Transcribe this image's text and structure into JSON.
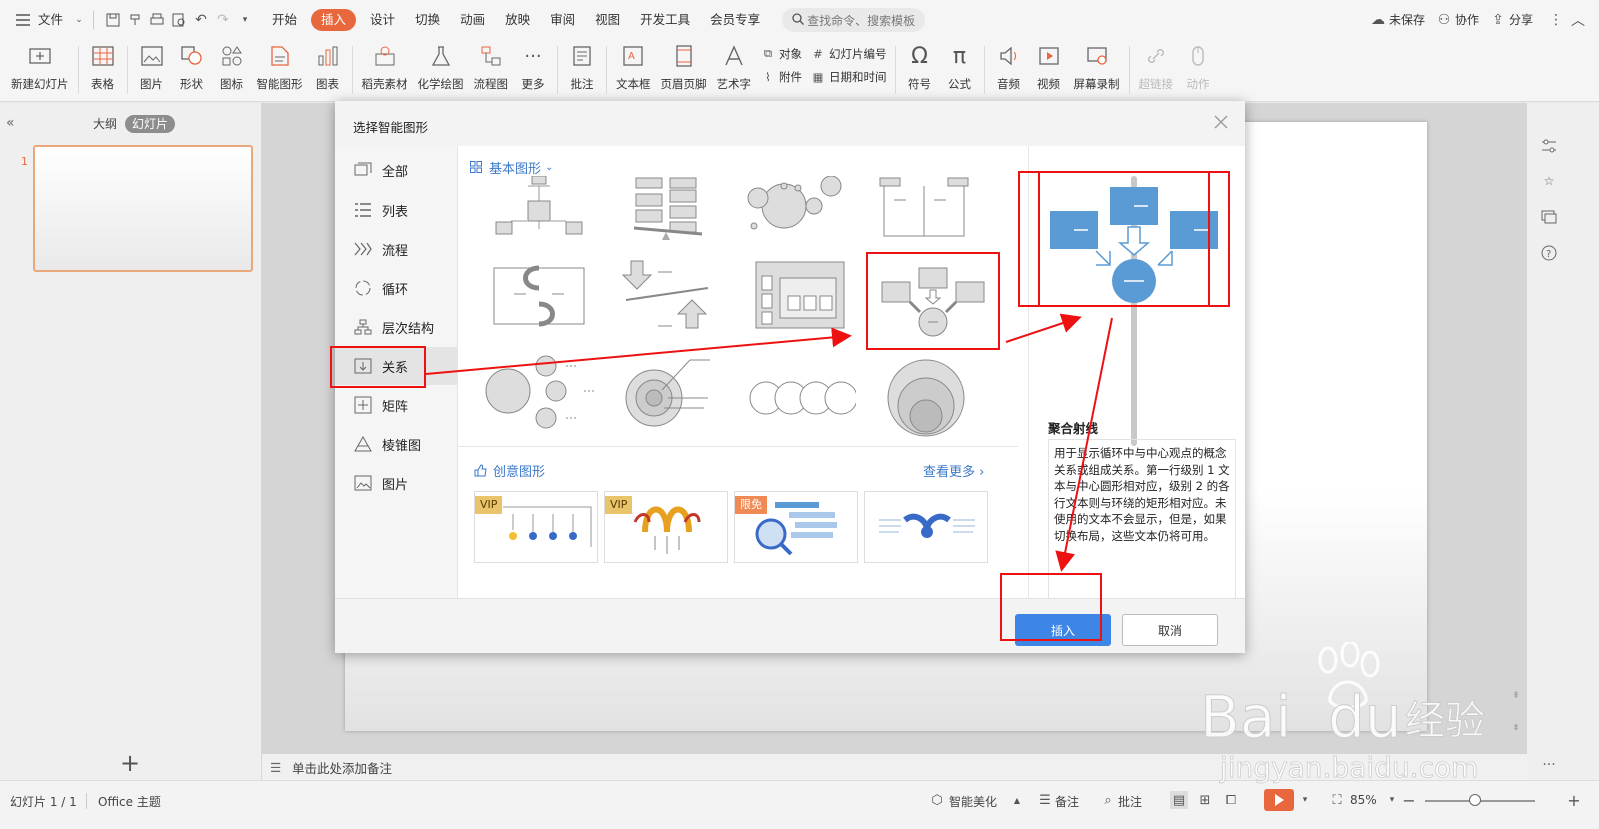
{
  "menubar": {
    "file": "文件",
    "tabs": [
      "开始",
      "插入",
      "设计",
      "切换",
      "动画",
      "放映",
      "审阅",
      "视图",
      "开发工具",
      "会员专享"
    ],
    "active_tab": "插入",
    "search_placeholder": "查找命令、搜索模板",
    "unsaved": "未保存",
    "collab": "协作",
    "share": "分享"
  },
  "ribbon": {
    "new_slide": "新建幻灯片",
    "table": "表格",
    "picture": "图片",
    "shape": "形状",
    "icon": "图标",
    "smart_art": "智能图形",
    "chart": "图表",
    "draft_material": "稻壳素材",
    "chem_draw": "化学绘图",
    "flowchart": "流程图",
    "more": "更多",
    "comment": "批注",
    "textbox": "文本框",
    "header_footer": "页眉页脚",
    "wordart": "艺术字",
    "object": "对象",
    "attachment": "附件",
    "slide_number": "幻灯片编号",
    "datetime": "日期和时间",
    "symbol": "符号",
    "formula": "公式",
    "audio": "音频",
    "video": "视频",
    "screen_record": "屏幕录制",
    "hyperlink": "超链接",
    "action": "动作"
  },
  "leftpanel": {
    "outline_tab": "大纲",
    "slides_tab": "幻灯片",
    "slide_number": "1"
  },
  "notes": {
    "placeholder": "单击此处添加备注"
  },
  "statusbar": {
    "slide_info": "幻灯片 1 / 1",
    "theme": "Office 主题",
    "smart_beautify": "智能美化",
    "notes": "备注",
    "comments": "批注",
    "zoom": "85%",
    "zoom_level": 0.45
  },
  "dialog": {
    "title": "选择智能图形",
    "categories": [
      "全部",
      "列表",
      "流程",
      "循环",
      "层次结构",
      "关系",
      "矩阵",
      "棱锥图",
      "图片"
    ],
    "selected_category": "关系",
    "basic_section": "基本图形",
    "creative_section": "创意图形",
    "see_more": "查看更多",
    "badges": [
      "VIP",
      "VIP",
      "限免"
    ],
    "preview_title": "聚合射线",
    "preview_desc": "用于显示循环中与中心观点的概念关系或组成关系。第一行级别 1 文本与中心圆形相对应，级别 2 的各行文本则与环绕的矩形相对应。未使用的文本不会显示，但是，如果切换布局，这些文本仍将可用。",
    "insert_btn": "插入",
    "cancel_btn": "取消"
  },
  "watermark": {
    "brand": "Bai du 经验",
    "url": "jingyan.baidu.com"
  },
  "colors": {
    "accent": "#e8673d",
    "insert_blue": "#3e86e6",
    "link_blue": "#3b78c8",
    "annotation_red": "#e11111",
    "diagram_blue": "#5b9bd5"
  }
}
